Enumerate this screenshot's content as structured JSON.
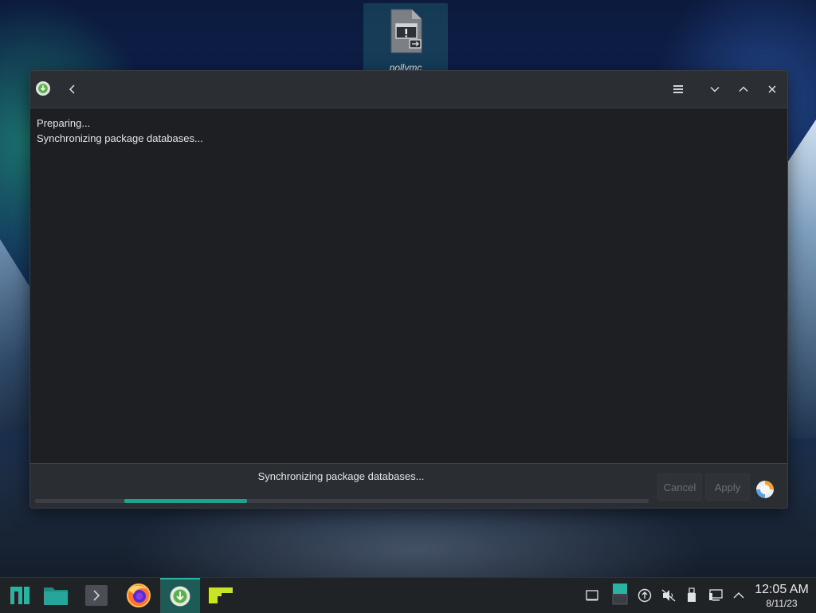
{
  "desktop": {
    "file_icon": {
      "label": "pollymc",
      "icon": "executable-file-icon"
    }
  },
  "window": {
    "titlebar": {
      "app_icon": "pamac-download-icon",
      "back_icon": "chevron-left-icon",
      "menu_icon": "hamburger-menu-icon",
      "minimize_icon": "chevron-down-icon",
      "maximize_icon": "chevron-up-icon",
      "close_icon": "close-icon"
    },
    "log_lines": [
      "Preparing...",
      "Synchronizing package databases..."
    ],
    "statusbar": {
      "status_text": "Synchronizing package databases...",
      "progress": 0.2,
      "cancel_label": "Cancel",
      "apply_label": "Apply",
      "status_icon": "details-status-icon"
    }
  },
  "taskbar": {
    "items": [
      {
        "name": "manjaro-menu-icon",
        "active": false
      },
      {
        "name": "file-manager-icon",
        "active": false
      },
      {
        "name": "terminal-icon",
        "active": false
      },
      {
        "name": "firefox-icon",
        "active": false
      },
      {
        "name": "pamac-icon",
        "active": true
      },
      {
        "name": "app-icon",
        "active": false
      }
    ],
    "tray": [
      "show-desktop-icon",
      "virtual-desktop-icon",
      "updates-icon",
      "volume-muted-icon",
      "usb-device-icon",
      "network-icon",
      "tray-expand-icon"
    ],
    "clock": {
      "time": "12:05 AM",
      "date": "8/11/23"
    }
  },
  "colors": {
    "accent": "#1fa38f",
    "window_bg": "#1d1f22",
    "titlebar_bg": "#2b2e33",
    "taskbar_bg": "#202326"
  }
}
